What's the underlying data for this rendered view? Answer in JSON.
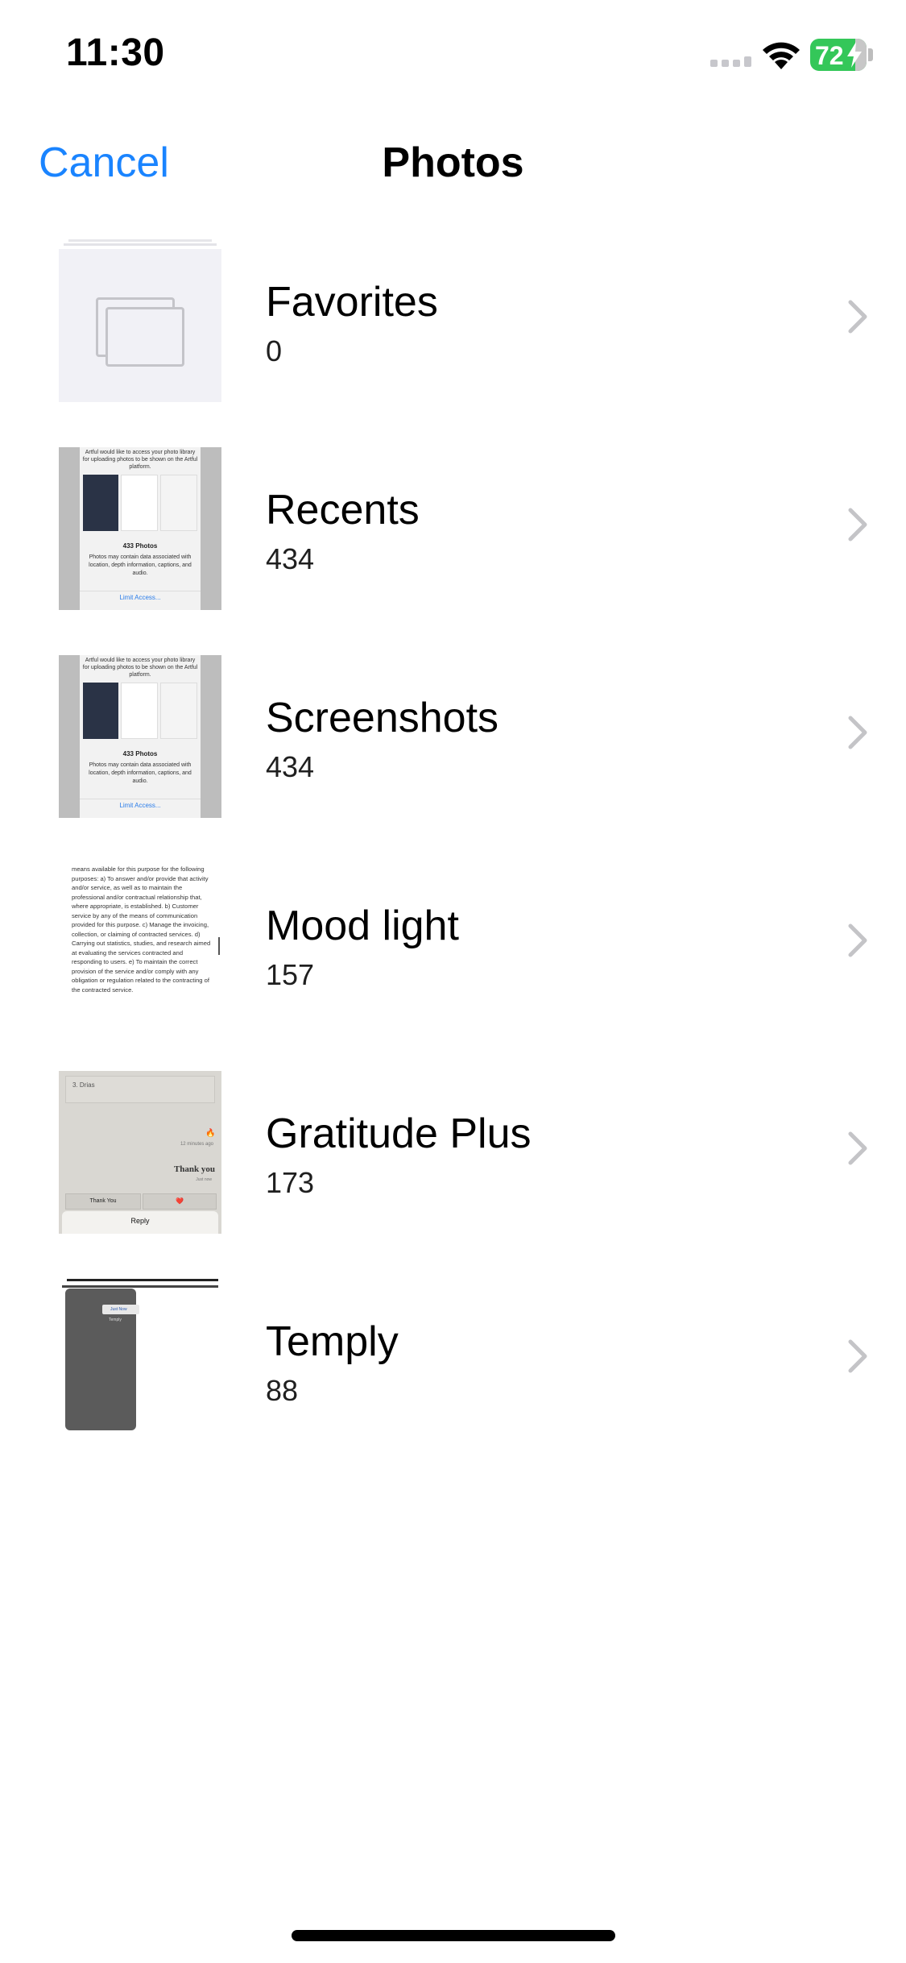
{
  "status_bar": {
    "time": "11:30",
    "battery_percent": "72",
    "battery_color": "#34c759",
    "icons": [
      "cellular-signal-icon",
      "wifi-icon",
      "battery-charging-icon"
    ]
  },
  "nav": {
    "cancel_label": "Cancel",
    "title": "Photos",
    "accent_color": "#1a84ff"
  },
  "albums": [
    {
      "name": "Favorites",
      "count": "0"
    },
    {
      "name": "Recents",
      "count": "434"
    },
    {
      "name": "Screenshots",
      "count": "434"
    },
    {
      "name": "Mood light",
      "count": "157"
    },
    {
      "name": "Gratitude Plus",
      "count": "173"
    },
    {
      "name": "Temply",
      "count": "88"
    }
  ],
  "thumbnails": {
    "recents": {
      "header": "Artful would like to access your photo library for uploading photos to be shown on the Artful platform.",
      "count": "433 Photos",
      "description": "Photos may contain data associated with location, depth information, captions, and audio.",
      "link": "Limit Access..."
    },
    "screenshots": {
      "header": "Artful would like to access your photo library for uploading photos to be shown on the Artful platform.",
      "count": "433 Photos",
      "description": "Photos may contain data associated with location, depth information, captions, and audio.",
      "link": "Limit Access..."
    },
    "mood_light": {
      "text": "means available for this purpose for the following purposes: a) To answer and/or provide that activity and/or service, as well as to maintain the professional and/or contractual relationship that, where appropriate, is established. b) Customer service by any of the means of communication provided for this purpose. c) Manage the invoicing, collection, or claiming of contracted services. d) Carrying out statistics, studies, and research aimed at evaluating the services contracted and responding to users. e) To maintain the correct provision of the service and/or comply with any obligation or regulation related to the contracting of the contracted service."
    },
    "gratitude": {
      "field": "3. Drias",
      "time": "12 minutes ago",
      "message": "Thank you",
      "message_time": "Just now",
      "button_thank": "Thank You",
      "button_heart": "❤️",
      "reply": "Reply"
    },
    "temply": {
      "card": "Just Now",
      "row": "Temply"
    }
  }
}
